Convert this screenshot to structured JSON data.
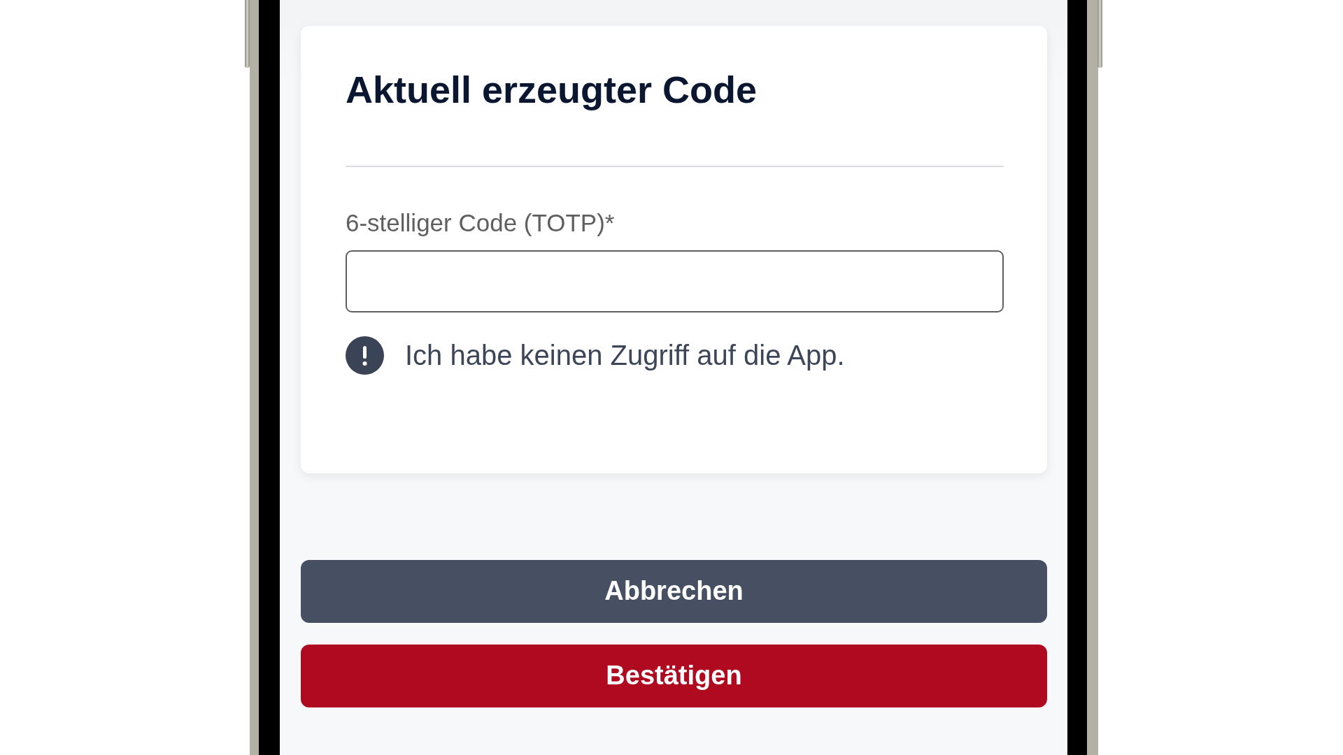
{
  "card": {
    "title": "Aktuell erzeugter Code",
    "code_field": {
      "label": "6-stelliger Code (TOTP)*"
    },
    "help_link": {
      "text": "Ich habe keinen Zugriff auf die App."
    }
  },
  "buttons": [
    {
      "label": "Abbrechen",
      "kind": "secondary"
    },
    {
      "label": "Bestätigen",
      "kind": "primary"
    }
  ]
}
